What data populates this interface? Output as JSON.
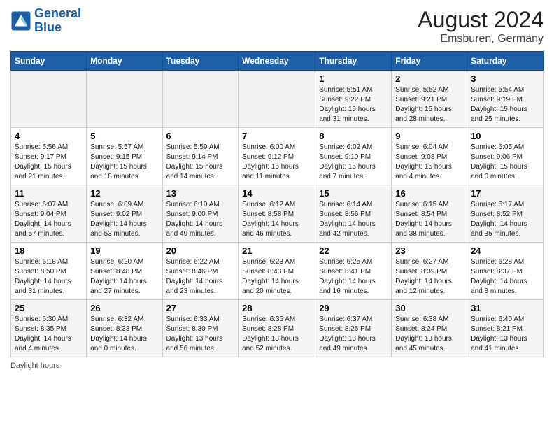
{
  "header": {
    "logo_line1": "General",
    "logo_line2": "Blue",
    "title": "August 2024",
    "subtitle": "Emsburen, Germany"
  },
  "calendar": {
    "days_of_week": [
      "Sunday",
      "Monday",
      "Tuesday",
      "Wednesday",
      "Thursday",
      "Friday",
      "Saturday"
    ],
    "weeks": [
      [
        {
          "day": "",
          "info": ""
        },
        {
          "day": "",
          "info": ""
        },
        {
          "day": "",
          "info": ""
        },
        {
          "day": "",
          "info": ""
        },
        {
          "day": "1",
          "info": "Sunrise: 5:51 AM\nSunset: 9:22 PM\nDaylight: 15 hours\nand 31 minutes."
        },
        {
          "day": "2",
          "info": "Sunrise: 5:52 AM\nSunset: 9:21 PM\nDaylight: 15 hours\nand 28 minutes."
        },
        {
          "day": "3",
          "info": "Sunrise: 5:54 AM\nSunset: 9:19 PM\nDaylight: 15 hours\nand 25 minutes."
        }
      ],
      [
        {
          "day": "4",
          "info": "Sunrise: 5:56 AM\nSunset: 9:17 PM\nDaylight: 15 hours\nand 21 minutes."
        },
        {
          "day": "5",
          "info": "Sunrise: 5:57 AM\nSunset: 9:15 PM\nDaylight: 15 hours\nand 18 minutes."
        },
        {
          "day": "6",
          "info": "Sunrise: 5:59 AM\nSunset: 9:14 PM\nDaylight: 15 hours\nand 14 minutes."
        },
        {
          "day": "7",
          "info": "Sunrise: 6:00 AM\nSunset: 9:12 PM\nDaylight: 15 hours\nand 11 minutes."
        },
        {
          "day": "8",
          "info": "Sunrise: 6:02 AM\nSunset: 9:10 PM\nDaylight: 15 hours\nand 7 minutes."
        },
        {
          "day": "9",
          "info": "Sunrise: 6:04 AM\nSunset: 9:08 PM\nDaylight: 15 hours\nand 4 minutes."
        },
        {
          "day": "10",
          "info": "Sunrise: 6:05 AM\nSunset: 9:06 PM\nDaylight: 15 hours\nand 0 minutes."
        }
      ],
      [
        {
          "day": "11",
          "info": "Sunrise: 6:07 AM\nSunset: 9:04 PM\nDaylight: 14 hours\nand 57 minutes."
        },
        {
          "day": "12",
          "info": "Sunrise: 6:09 AM\nSunset: 9:02 PM\nDaylight: 14 hours\nand 53 minutes."
        },
        {
          "day": "13",
          "info": "Sunrise: 6:10 AM\nSunset: 9:00 PM\nDaylight: 14 hours\nand 49 minutes."
        },
        {
          "day": "14",
          "info": "Sunrise: 6:12 AM\nSunset: 8:58 PM\nDaylight: 14 hours\nand 46 minutes."
        },
        {
          "day": "15",
          "info": "Sunrise: 6:14 AM\nSunset: 8:56 PM\nDaylight: 14 hours\nand 42 minutes."
        },
        {
          "day": "16",
          "info": "Sunrise: 6:15 AM\nSunset: 8:54 PM\nDaylight: 14 hours\nand 38 minutes."
        },
        {
          "day": "17",
          "info": "Sunrise: 6:17 AM\nSunset: 8:52 PM\nDaylight: 14 hours\nand 35 minutes."
        }
      ],
      [
        {
          "day": "18",
          "info": "Sunrise: 6:18 AM\nSunset: 8:50 PM\nDaylight: 14 hours\nand 31 minutes."
        },
        {
          "day": "19",
          "info": "Sunrise: 6:20 AM\nSunset: 8:48 PM\nDaylight: 14 hours\nand 27 minutes."
        },
        {
          "day": "20",
          "info": "Sunrise: 6:22 AM\nSunset: 8:46 PM\nDaylight: 14 hours\nand 23 minutes."
        },
        {
          "day": "21",
          "info": "Sunrise: 6:23 AM\nSunset: 8:43 PM\nDaylight: 14 hours\nand 20 minutes."
        },
        {
          "day": "22",
          "info": "Sunrise: 6:25 AM\nSunset: 8:41 PM\nDaylight: 14 hours\nand 16 minutes."
        },
        {
          "day": "23",
          "info": "Sunrise: 6:27 AM\nSunset: 8:39 PM\nDaylight: 14 hours\nand 12 minutes."
        },
        {
          "day": "24",
          "info": "Sunrise: 6:28 AM\nSunset: 8:37 PM\nDaylight: 14 hours\nand 8 minutes."
        }
      ],
      [
        {
          "day": "25",
          "info": "Sunrise: 6:30 AM\nSunset: 8:35 PM\nDaylight: 14 hours\nand 4 minutes."
        },
        {
          "day": "26",
          "info": "Sunrise: 6:32 AM\nSunset: 8:33 PM\nDaylight: 14 hours\nand 0 minutes."
        },
        {
          "day": "27",
          "info": "Sunrise: 6:33 AM\nSunset: 8:30 PM\nDaylight: 13 hours\nand 56 minutes."
        },
        {
          "day": "28",
          "info": "Sunrise: 6:35 AM\nSunset: 8:28 PM\nDaylight: 13 hours\nand 52 minutes."
        },
        {
          "day": "29",
          "info": "Sunrise: 6:37 AM\nSunset: 8:26 PM\nDaylight: 13 hours\nand 49 minutes."
        },
        {
          "day": "30",
          "info": "Sunrise: 6:38 AM\nSunset: 8:24 PM\nDaylight: 13 hours\nand 45 minutes."
        },
        {
          "day": "31",
          "info": "Sunrise: 6:40 AM\nSunset: 8:21 PM\nDaylight: 13 hours\nand 41 minutes."
        }
      ]
    ],
    "legend": "Daylight hours"
  }
}
